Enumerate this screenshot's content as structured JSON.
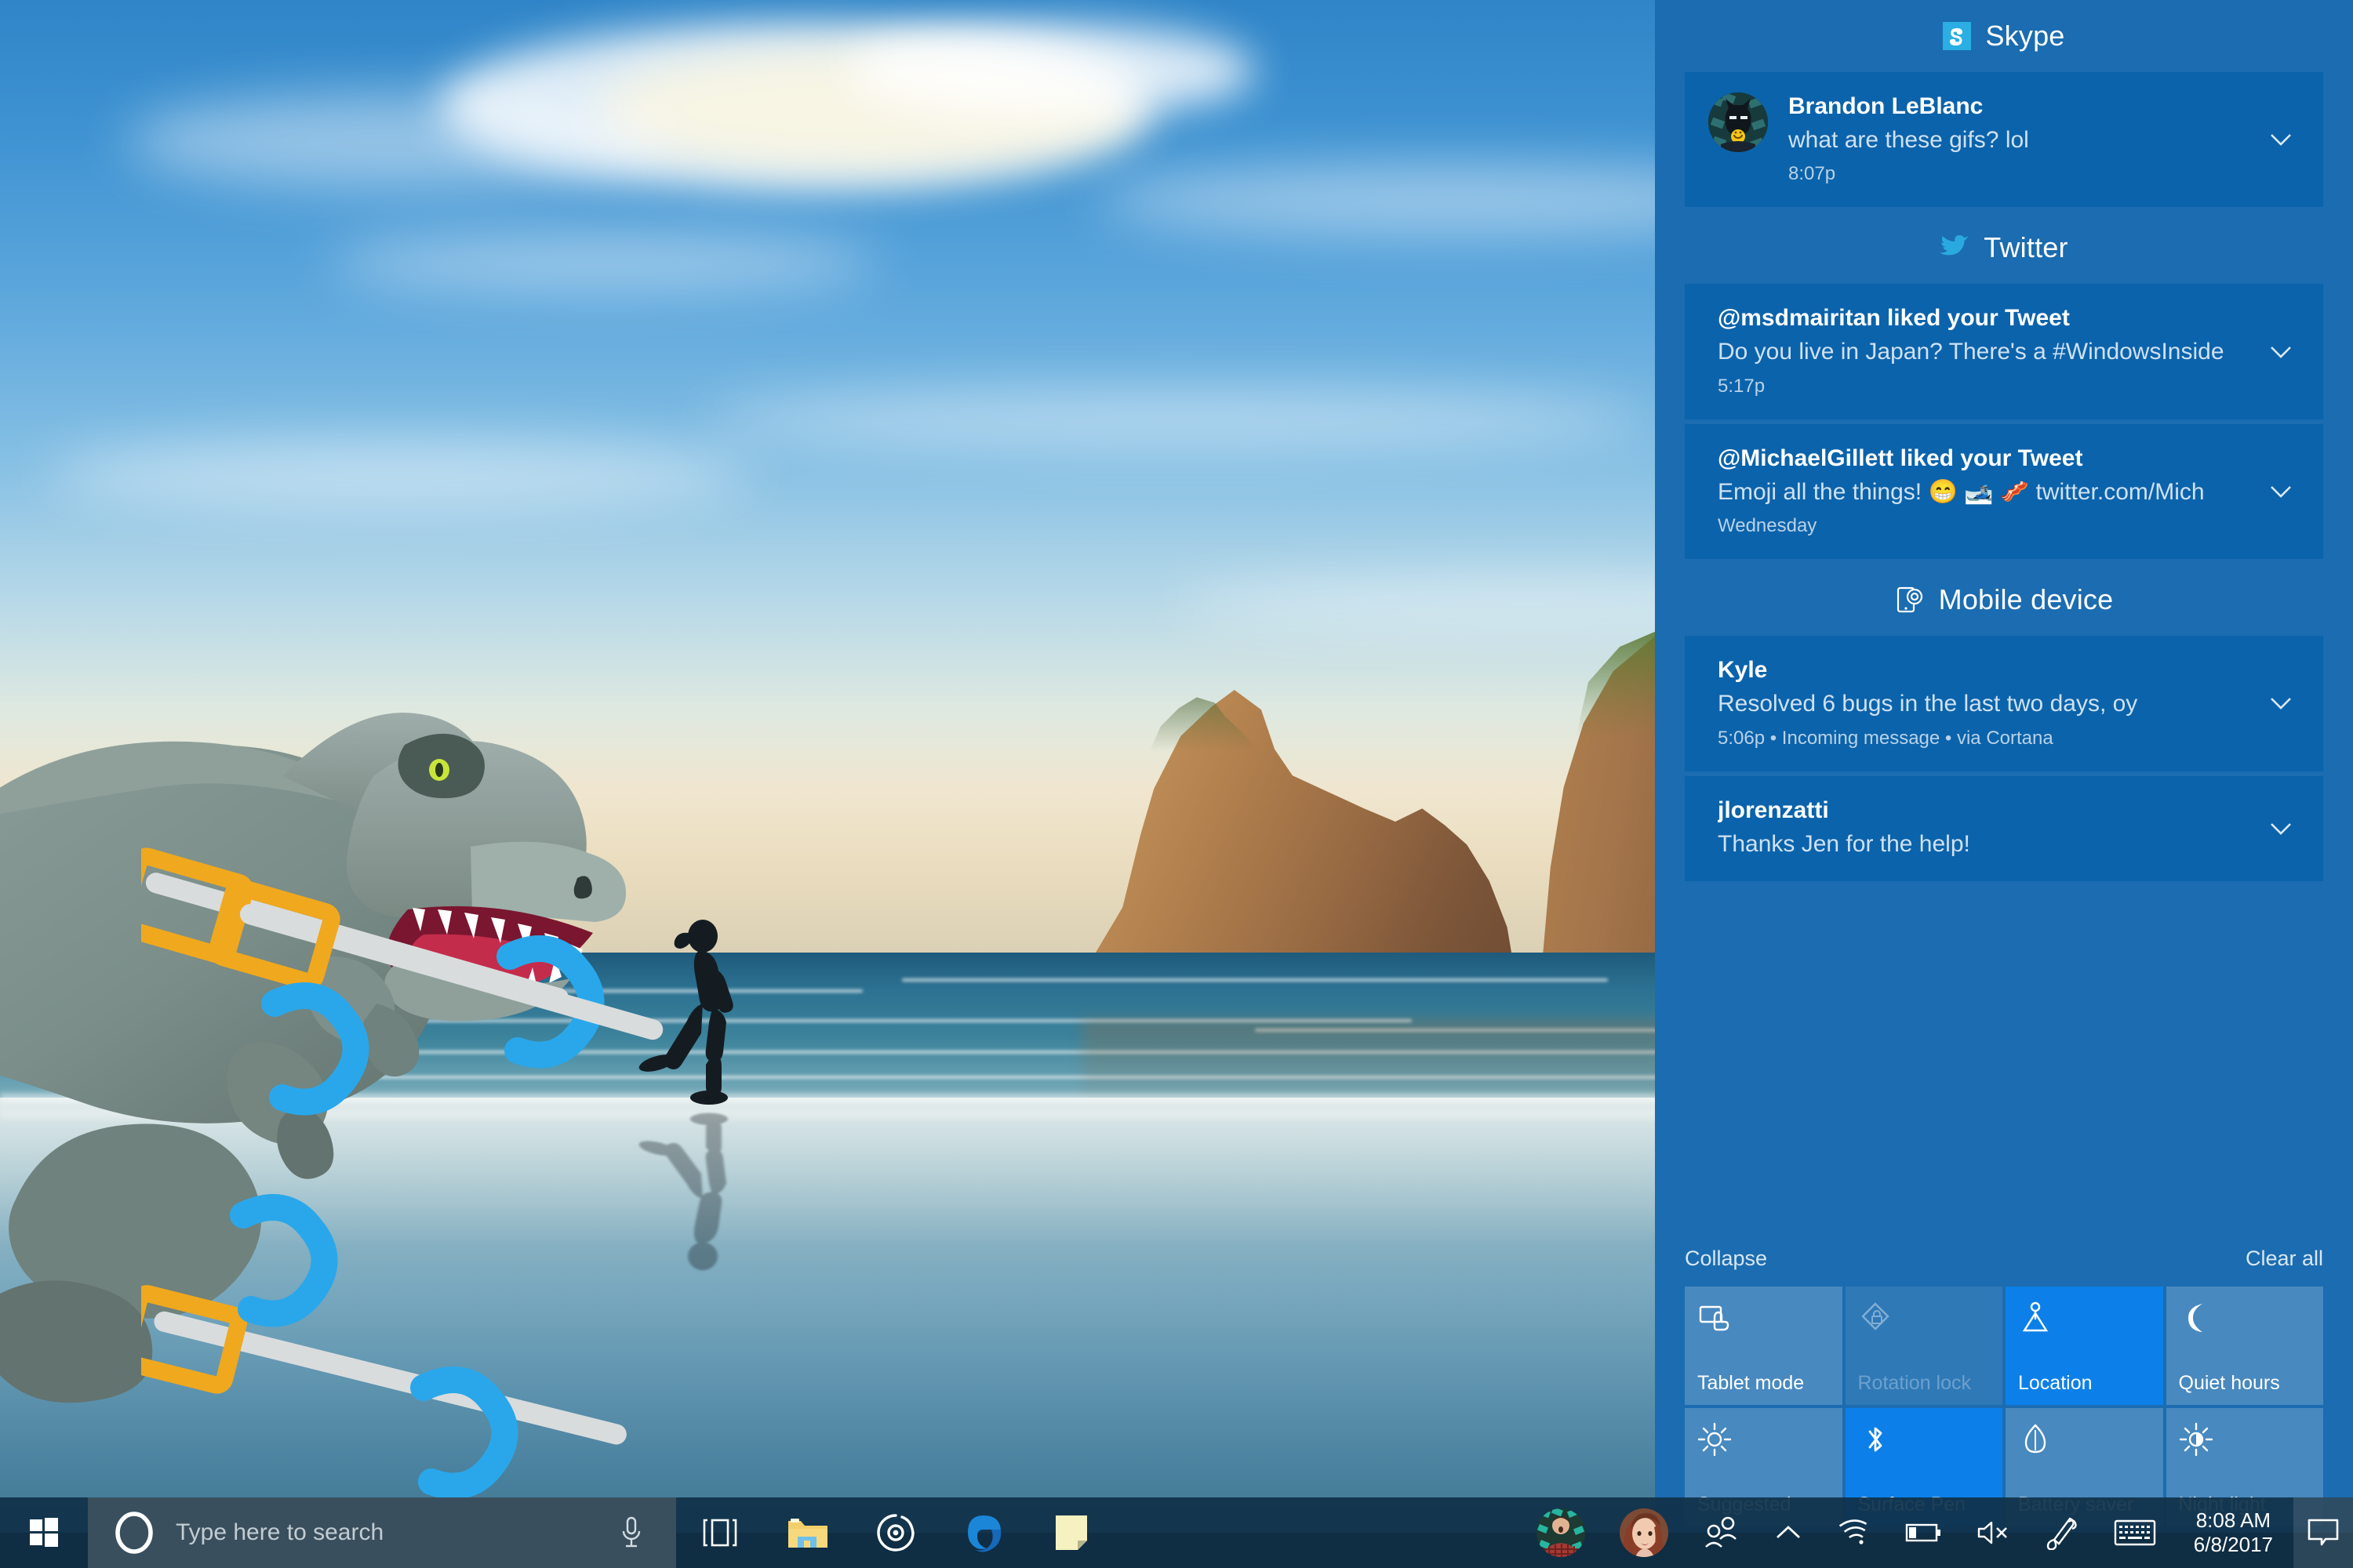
{
  "action_center": {
    "groups": [
      {
        "app": "Skype",
        "icon": "skype-icon",
        "notifications": [
          {
            "avatar": "brandon-avatar",
            "title": "Brandon LeBlanc",
            "message": "what are these gifs? lol",
            "meta": "8:07p"
          }
        ]
      },
      {
        "app": "Twitter",
        "icon": "twitter-icon",
        "notifications": [
          {
            "title": "@msdmairitan liked your Tweet",
            "message": "Do you live in Japan? There's a #WindowsInside",
            "meta": "5:17p"
          },
          {
            "title": "@MichaelGillett liked your Tweet",
            "message": "Emoji all the things! 😁 🎿 🥓 twitter.com/Mich",
            "meta": "Wednesday"
          }
        ]
      },
      {
        "app": "Mobile device",
        "icon": "mobile-device-icon",
        "notifications": [
          {
            "title": "Kyle",
            "message": "Resolved 6 bugs in the last two days, oy",
            "meta": "5:06p • Incoming message • via Cortana"
          },
          {
            "title": "jlorenzatti",
            "message": "Thanks Jen for the help!",
            "meta": ""
          }
        ]
      }
    ],
    "collapse_label": "Collapse",
    "clear_all_label": "Clear all",
    "quick_actions": [
      {
        "label": "Tablet mode",
        "icon": "tablet-mode-icon",
        "state": "off"
      },
      {
        "label": "Rotation lock",
        "icon": "rotation-lock-icon",
        "state": "disabled"
      },
      {
        "label": "Location",
        "icon": "location-icon",
        "state": "on"
      },
      {
        "label": "Quiet hours",
        "icon": "moon-icon",
        "state": "off"
      },
      {
        "label": "Suggested",
        "icon": "brightness-icon",
        "state": "off"
      },
      {
        "label": "Surface Pen",
        "icon": "bluetooth-icon",
        "state": "on"
      },
      {
        "label": "Battery saver",
        "icon": "leaf-icon",
        "state": "off"
      },
      {
        "label": "Night light",
        "icon": "night-light-icon",
        "state": "off"
      }
    ],
    "colors": {
      "panel_bg": "#1b6cb0",
      "card_bg": "#0b63ab",
      "tile_on": "#0c80e8",
      "tile_off": "rgba(255,255,255,0.20)"
    }
  },
  "taskbar": {
    "start_label": "Start",
    "search": {
      "placeholder": "Type here to search",
      "cortana_icon": "cortana-circle-icon",
      "mic_icon": "microphone-icon"
    },
    "apps": [
      {
        "name": "Task view",
        "icon": "task-view-icon",
        "running": false
      },
      {
        "name": "File Explorer",
        "icon": "file-explorer-icon",
        "running": true
      },
      {
        "name": "Groove Music",
        "icon": "groove-music-icon",
        "running": true
      },
      {
        "name": "Microsoft Edge",
        "icon": "edge-icon",
        "running": true
      },
      {
        "name": "Sticky Notes",
        "icon": "sticky-notes-icon",
        "running": true
      }
    ],
    "tray": [
      {
        "name": "contact-1",
        "icon": "my-people-avatar-1"
      },
      {
        "name": "contact-2",
        "icon": "my-people-avatar-2"
      },
      {
        "name": "My People",
        "icon": "my-people-icon"
      },
      {
        "name": "Show hidden icons",
        "icon": "chevron-up-icon"
      },
      {
        "name": "Network",
        "icon": "wifi-icon"
      },
      {
        "name": "Battery",
        "icon": "battery-icon"
      },
      {
        "name": "Volume muted",
        "icon": "volume-muted-icon"
      },
      {
        "name": "Windows Ink Workspace",
        "icon": "pen-icon"
      },
      {
        "name": "Touch keyboard",
        "icon": "keyboard-icon"
      }
    ],
    "clock": {
      "time": "8:08 AM",
      "date": "6/8/2017"
    },
    "action_center_icon": "action-center-icon",
    "colors": {
      "taskbar_bg": "#103048",
      "search_bg": "#3a4f5d"
    }
  },
  "desktop": {
    "wallpaper": "wharariki-beach",
    "overlay_art": "trex-skiing-cartoon"
  }
}
